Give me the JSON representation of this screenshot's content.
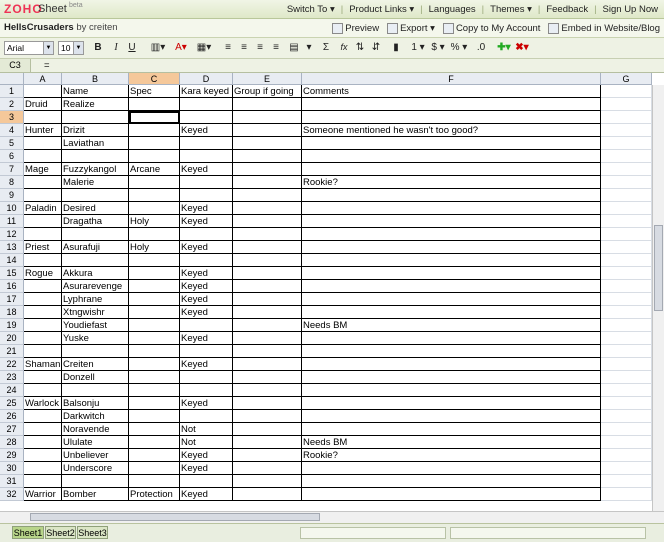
{
  "app": {
    "logo": "ZOHO",
    "product": "Sheet",
    "beta": "beta"
  },
  "topnav": [
    "Switch To ▾",
    "Product Links ▾",
    "Languages",
    "Themes ▾",
    "Feedback",
    "Sign Up Now"
  ],
  "doc": {
    "title": "HellsCrusaders",
    "by": "by creiten"
  },
  "actions": {
    "preview": "Preview",
    "export": "Export ▾",
    "copy": "Copy to My Account",
    "embed": "Embed in Website/Blog"
  },
  "toolbar": {
    "font": "Arial",
    "size": "10",
    "bold": "B",
    "italic": "I",
    "underline": "U",
    "sum": "Σ",
    "fx": "fx",
    "dollar": "$ ▾",
    "percent": "% ▾",
    "one": "1 ▾"
  },
  "formula": {
    "cellref": "C3",
    "eq": "="
  },
  "columns": [
    "A",
    "B",
    "C",
    "D",
    "E",
    "F",
    "G"
  ],
  "rows": [
    [
      "",
      "Name",
      "Spec",
      "Kara keyed",
      "Group if going",
      "Comments"
    ],
    [
      "Druid",
      "Realize",
      "",
      "",
      "",
      ""
    ],
    [
      "",
      "",
      "",
      "",
      "",
      ""
    ],
    [
      "Hunter",
      "Drizit",
      "",
      "Keyed",
      "",
      "Someone mentioned he wasn't too good?"
    ],
    [
      "",
      "Laviathan",
      "",
      "",
      "",
      ""
    ],
    [
      "",
      "",
      "",
      "",
      "",
      ""
    ],
    [
      "Mage",
      "Fuzzykangol",
      "Arcane",
      "Keyed",
      "",
      ""
    ],
    [
      "",
      "Malerie",
      "",
      "",
      "",
      "Rookie?"
    ],
    [
      "",
      "",
      "",
      "",
      "",
      ""
    ],
    [
      "Paladin",
      "Desired",
      "",
      "Keyed",
      "",
      ""
    ],
    [
      "",
      "Dragatha",
      "Holy",
      "Keyed",
      "",
      ""
    ],
    [
      "",
      "",
      "",
      "",
      "",
      ""
    ],
    [
      "Priest",
      "Asurafuji",
      "Holy",
      "Keyed",
      "",
      ""
    ],
    [
      "",
      "",
      "",
      "",
      "",
      ""
    ],
    [
      "Rogue",
      "Akkura",
      "",
      "Keyed",
      "",
      ""
    ],
    [
      "",
      "Asurarevenge",
      "",
      "Keyed",
      "",
      ""
    ],
    [
      "",
      "Lyphrane",
      "",
      "Keyed",
      "",
      ""
    ],
    [
      "",
      "Xtngwishr",
      "",
      "Keyed",
      "",
      ""
    ],
    [
      "",
      "Youdiefast",
      "",
      "",
      "",
      "Needs BM"
    ],
    [
      "",
      "Yuske",
      "",
      "Keyed",
      "",
      ""
    ],
    [
      "",
      "",
      "",
      "",
      "",
      ""
    ],
    [
      "Shaman",
      "Creiten",
      "",
      "Keyed",
      "",
      ""
    ],
    [
      "",
      "Donzell",
      "",
      "",
      "",
      ""
    ],
    [
      "",
      "",
      "",
      "",
      "",
      ""
    ],
    [
      "Warlock",
      "Balsonju",
      "",
      "Keyed",
      "",
      ""
    ],
    [
      "",
      "Darkwitch",
      "",
      "",
      "",
      ""
    ],
    [
      "",
      "Noravende",
      "",
      "Not",
      "",
      ""
    ],
    [
      "",
      "Ululate",
      "",
      "Not",
      "",
      "Needs BM"
    ],
    [
      "",
      "Unbeliever",
      "",
      "Keyed",
      "",
      "Rookie?"
    ],
    [
      "",
      "Underscore",
      "",
      "Keyed",
      "",
      ""
    ],
    [
      "",
      "",
      "",
      "",
      "",
      ""
    ],
    [
      "Warrior",
      "Bomber",
      "Protection",
      "Keyed",
      "",
      ""
    ]
  ],
  "sheets": [
    "Sheet1",
    "Sheet2",
    "Sheet3"
  ]
}
